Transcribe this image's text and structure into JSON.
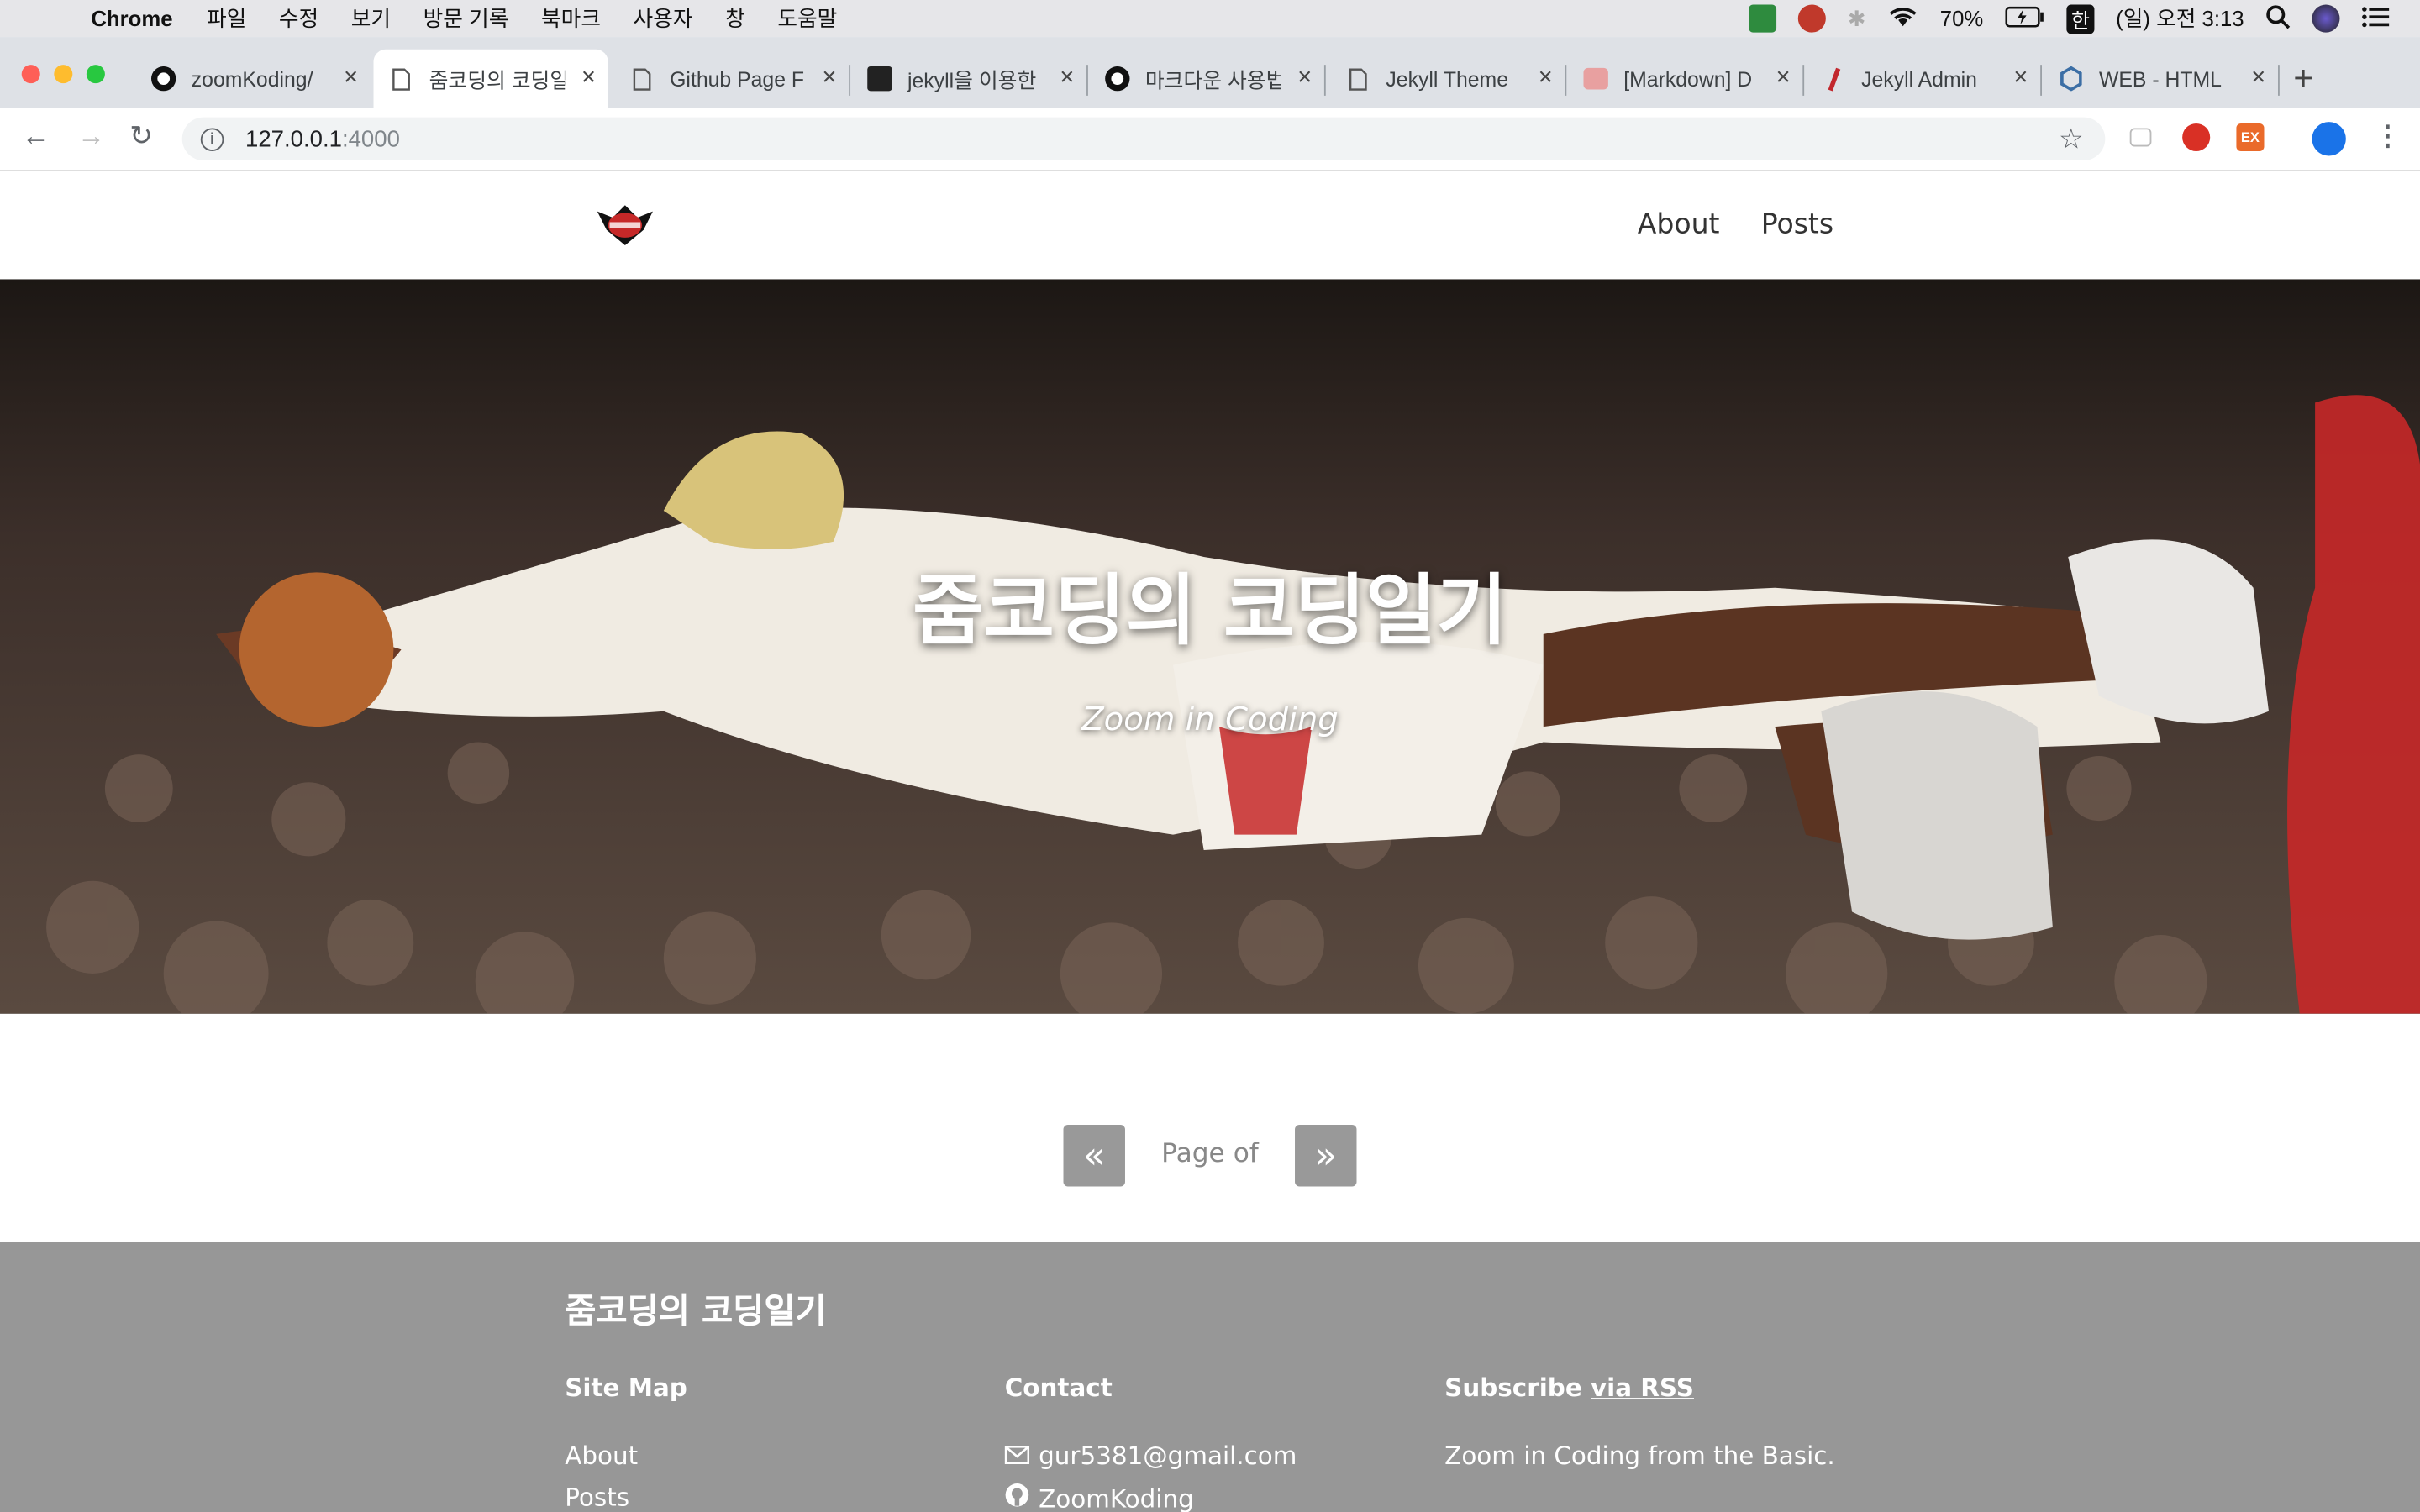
{
  "menubar": {
    "app": "Chrome",
    "items": [
      "파일",
      "수정",
      "보기",
      "방문 기록",
      "북마크",
      "사용자",
      "창",
      "도움말"
    ],
    "battery": "70%",
    "ime": "한",
    "clock": "(일) 오전 3:13"
  },
  "tabs": [
    {
      "title": "zoomKoding/",
      "icon": "github-icon"
    },
    {
      "title": "줌코딩의 코딩일",
      "icon": "page-icon",
      "active": true
    },
    {
      "title": "Github Page F",
      "icon": "page-icon"
    },
    {
      "title": "jekyll을 이용한",
      "icon": "blog-icon"
    },
    {
      "title": "마크다운 사용법",
      "icon": "github-icon"
    },
    {
      "title": "Jekyll Theme",
      "icon": "page-icon"
    },
    {
      "title": "[Markdown] D",
      "icon": "markdown-icon"
    },
    {
      "title": "Jekyll Admin",
      "icon": "jekyll-icon"
    },
    {
      "title": "WEB - HTML",
      "icon": "hex-icon"
    }
  ],
  "address": {
    "host": "127.0.0.1",
    "port": ":4000"
  },
  "site": {
    "nav": {
      "about": "About",
      "posts": "Posts"
    },
    "hero_title": "줌코딩의 코딩일기",
    "hero_subtitle": "Zoom in Coding",
    "pagination": {
      "prev": "«",
      "text": "Page of",
      "next": "»"
    },
    "footer": {
      "title": "줌코딩의 코딩일기",
      "sitemap_heading": "Site Map",
      "sitemap_links": [
        "About",
        "Posts"
      ],
      "contact_heading": "Contact",
      "email": "gur5381@gmail.com",
      "github": "ZoomKoding",
      "subscribe_heading": "Subscribe",
      "subscribe_link": "via RSS",
      "subscribe_text": "Zoom in Coding from the Basic."
    }
  },
  "colors": {
    "footer_bg": "#979797",
    "pagination_btn": "#999999"
  }
}
